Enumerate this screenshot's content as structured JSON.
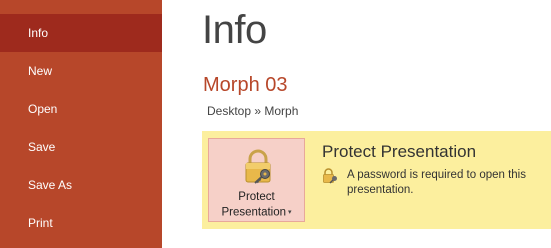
{
  "sidebar": {
    "items": [
      {
        "label": "Info"
      },
      {
        "label": "New"
      },
      {
        "label": "Open"
      },
      {
        "label": "Save"
      },
      {
        "label": "Save As"
      },
      {
        "label": "Print"
      }
    ],
    "active_index": 0
  },
  "main": {
    "title": "Info",
    "document_name": "Morph 03",
    "breadcrumb": "Desktop » Morph"
  },
  "protect": {
    "button_line1": "Protect",
    "button_line2": "Presentation",
    "caret": "▾",
    "heading": "Protect Presentation",
    "description": "A password is required to open this presentation.",
    "icon": "lock-key-icon"
  },
  "colors": {
    "sidebar_bg": "#b7472a",
    "sidebar_active": "#9e2a1d",
    "accent_text": "#b7472a",
    "panel_bg": "#fcef9e",
    "button_bg": "#f6d0c8"
  }
}
